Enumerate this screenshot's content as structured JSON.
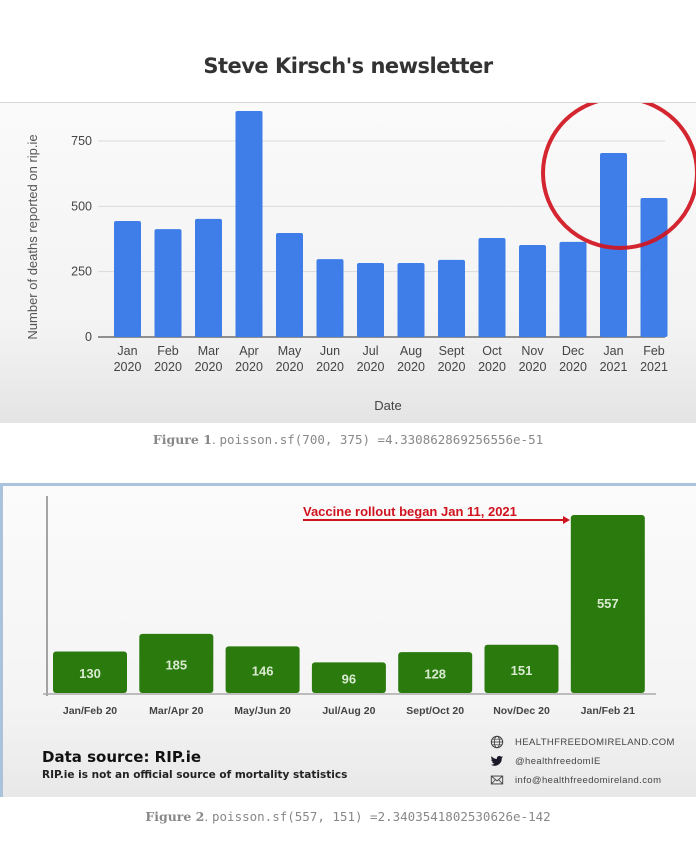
{
  "page": {
    "title": "Steve Kirsch's newsletter"
  },
  "figure1": {
    "caption_label": "Figure 1",
    "caption_text": "poisson.sf(700, 375) =4.330862869256556e-51"
  },
  "figure2": {
    "caption_label": "Figure 2",
    "caption_text": "poisson.sf(557, 151) =2.3403541802530626e-142",
    "annotation": "Vaccine rollout began Jan 11, 2021",
    "source_title": "Data source: RIP.ie",
    "source_note": "RIP.ie is not an official source of mortality statistics",
    "contacts": [
      {
        "icon": "globe-icon",
        "text": "HEALTHFREEDOMIRELAND.COM"
      },
      {
        "icon": "twitter-icon",
        "text": "@healthfreedomIE"
      },
      {
        "icon": "mail-icon",
        "text": "info@healthfreedomireland.com"
      }
    ]
  },
  "colors": {
    "bar_blue": "#3f7ee8",
    "bar_green": "#2a7a0e",
    "highlight_red": "#d0141f",
    "grid": "#d9d9d9"
  },
  "chart_data": [
    {
      "type": "bar",
      "title": "",
      "xlabel": "Date",
      "ylabel": "Number of deaths reported on rip.ie",
      "ylim": [
        0,
        900
      ],
      "yticks": [
        0,
        250,
        500,
        750
      ],
      "grid": true,
      "categories": [
        [
          "Jan",
          "2020"
        ],
        [
          "Feb",
          "2020"
        ],
        [
          "Mar",
          "2020"
        ],
        [
          "Apr",
          "2020"
        ],
        [
          "May",
          "2020"
        ],
        [
          "Jun",
          "2020"
        ],
        [
          "Jul",
          "2020"
        ],
        [
          "Aug",
          "2020"
        ],
        [
          "Sept",
          "2020"
        ],
        [
          "Oct",
          "2020"
        ],
        [
          "Nov",
          "2020"
        ],
        [
          "Dec",
          "2020"
        ],
        [
          "Jan",
          "2021"
        ],
        [
          "Feb",
          "2021"
        ]
      ],
      "values": [
        444,
        413,
        452,
        865,
        398,
        298,
        283,
        283,
        295,
        379,
        352,
        364,
        704,
        532
      ],
      "annotations": [
        "red circle highlighting Jan 2021 and Feb 2021 bars"
      ]
    },
    {
      "type": "bar",
      "title": "",
      "xlabel": "",
      "ylabel": "",
      "ylim": [
        0,
        600
      ],
      "grid": false,
      "categories": [
        "Jan/Feb 20",
        "Mar/Apr 20",
        "May/Jun 20",
        "Jul/Aug 20",
        "Sept/Oct 20",
        "Nov/Dec 20",
        "Jan/Feb 21"
      ],
      "values": [
        130,
        185,
        146,
        96,
        128,
        151,
        557
      ],
      "data_labels": [
        "130",
        "185",
        "146",
        "96",
        "128",
        "151",
        "557"
      ],
      "annotations": [
        "Vaccine rollout began Jan 11, 2021 (arrow pointing to Jan/Feb 21)"
      ]
    }
  ]
}
